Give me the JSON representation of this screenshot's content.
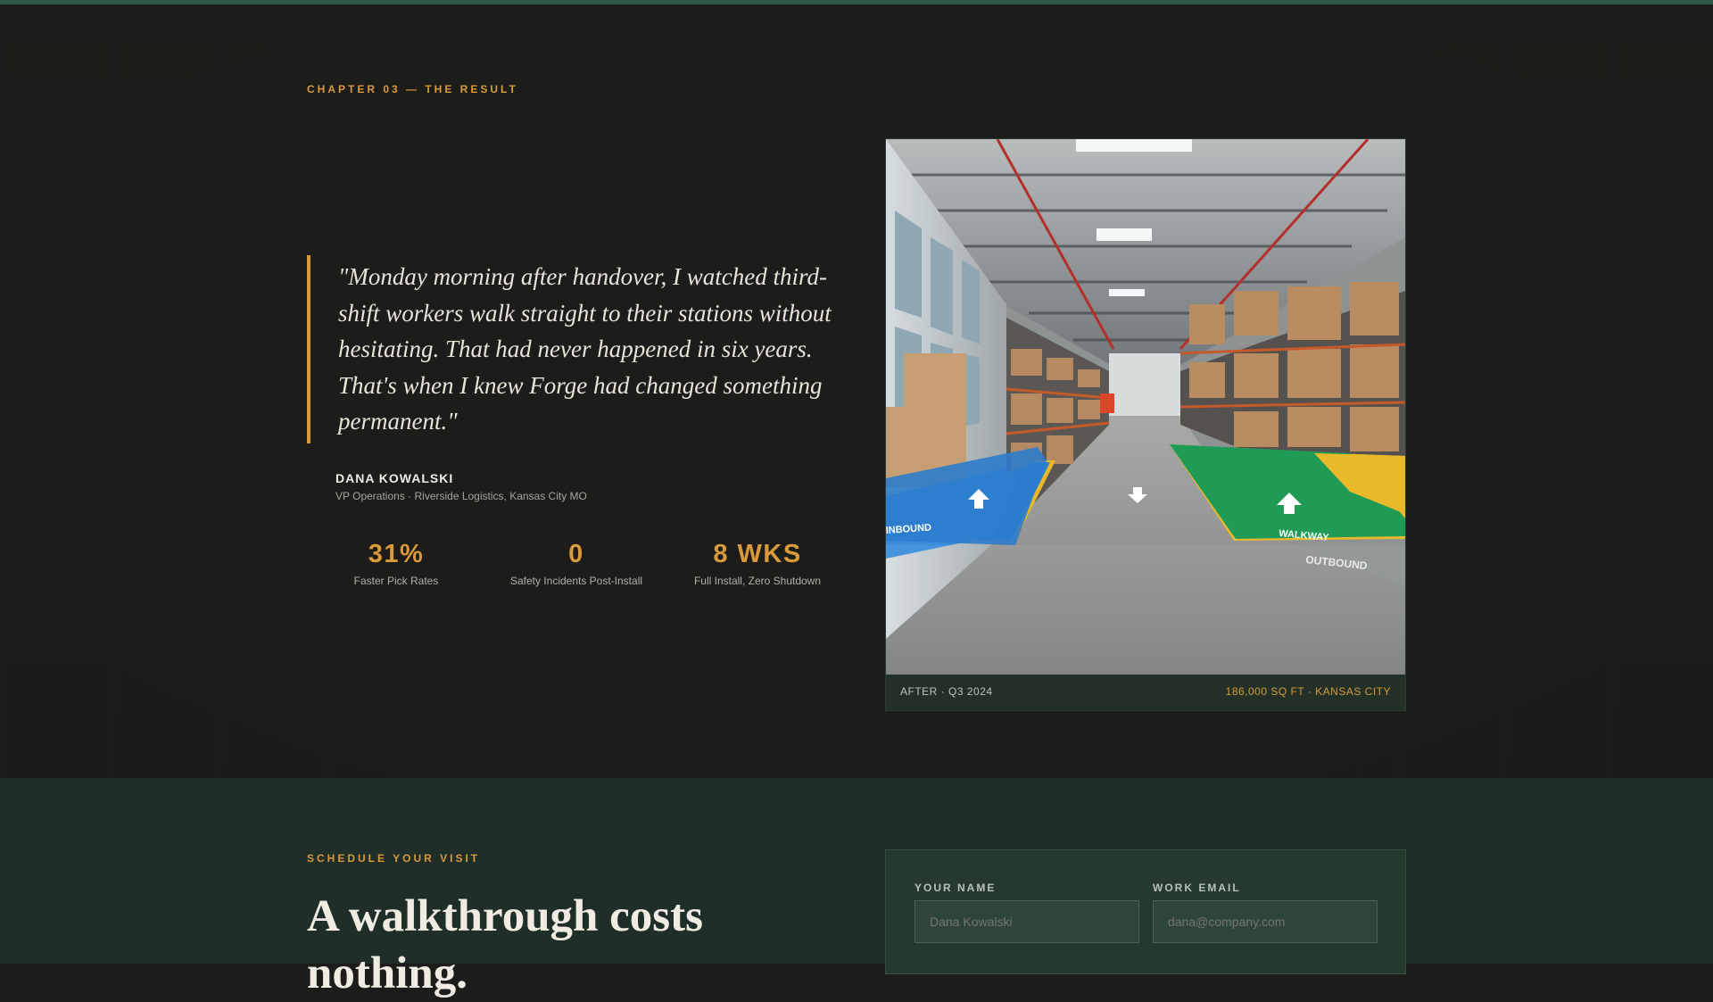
{
  "result": {
    "eyebrow": "CHAPTER 03 — THE RESULT",
    "quote": "\"Monday morning after handover, I watched third-shift workers walk straight to their stations without hesitating. That had never happened in six years. That's when I knew Forge had changed something permanent.\"",
    "author_name": "DANA KOWALSKI",
    "author_role": "VP Operations · Riverside Logistics, Kansas City MO",
    "stats": [
      {
        "value": "31%",
        "label": "Faster Pick Rates"
      },
      {
        "value": "0",
        "label": "Safety Incidents Post-Install"
      },
      {
        "value": "8 WKS",
        "label": "Full Install, Zero Shutdown"
      }
    ],
    "photo": {
      "floor_labels": [
        "INBOUND",
        "WALKWAY",
        "OUTBOUND"
      ],
      "caption_left": "AFTER · Q3 2024",
      "caption_right": "186,000 SQ FT · KANSAS CITY"
    }
  },
  "schedule": {
    "eyebrow": "SCHEDULE YOUR VISIT",
    "title_line1": "A walkthrough costs",
    "title_line2": "nothing.",
    "form": {
      "name_label": "YOUR NAME",
      "name_placeholder": "Dana Kowalski",
      "email_label": "WORK EMAIL",
      "email_placeholder": "dana@company.com"
    }
  },
  "colors": {
    "accent": "#d89a3a",
    "dark_bg": "#1d1d1b",
    "green_bg": "#1f2e28",
    "floor_blue": "#2f7fd0",
    "floor_green": "#1f9b55",
    "floor_yellow": "#e9b92a"
  }
}
